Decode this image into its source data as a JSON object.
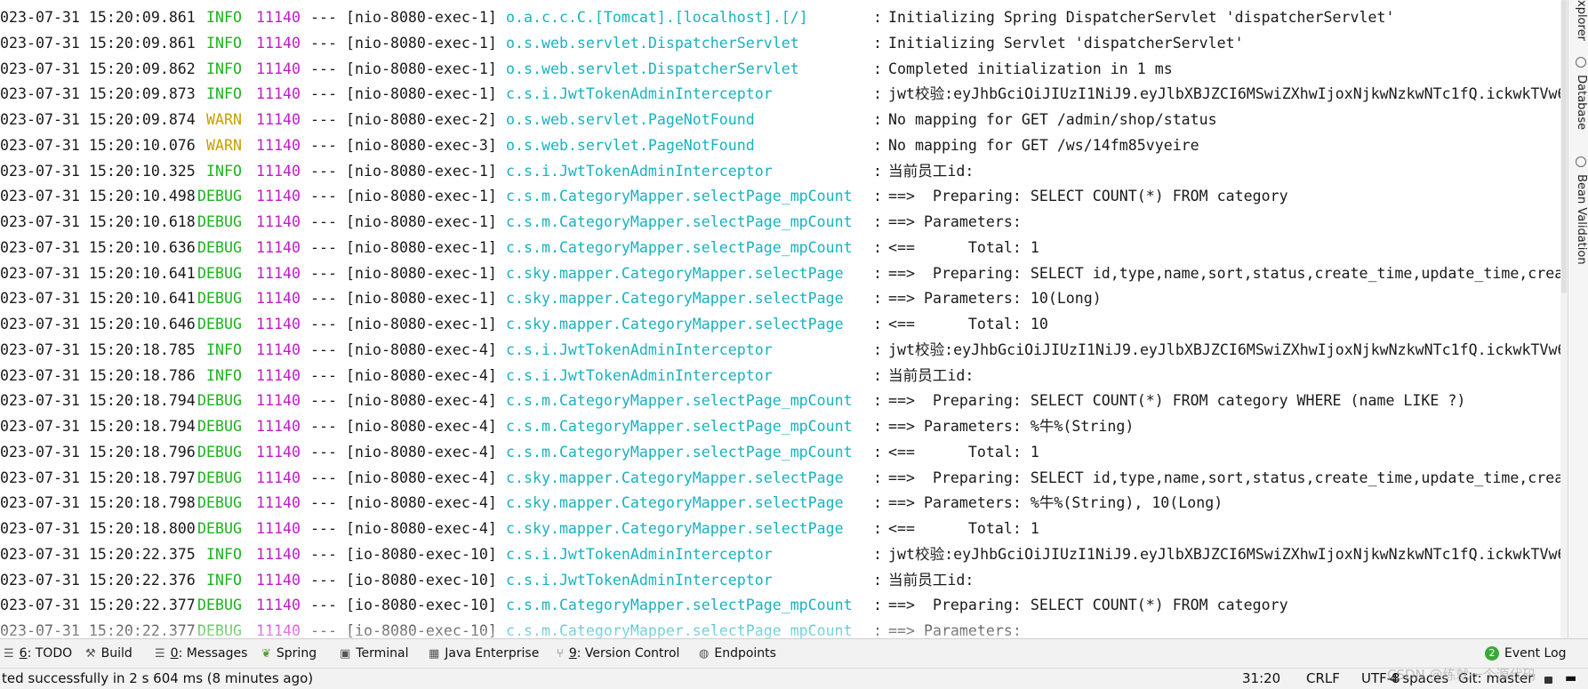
{
  "console": {
    "lines": [
      {
        "ts": "023-07-31 15:20:09.861",
        "level": " INFO",
        "pid": "11140",
        "sep": "---",
        "thread": "[nio-8080-exec-1]",
        "logger": "o.a.c.c.C.[Tomcat].[localhost].[/]",
        "msg": "Initializing Spring DispatcherServlet 'dispatcherServlet'"
      },
      {
        "ts": "023-07-31 15:20:09.861",
        "level": " INFO",
        "pid": "11140",
        "sep": "---",
        "thread": "[nio-8080-exec-1]",
        "logger": "o.s.web.servlet.DispatcherServlet",
        "msg": "Initializing Servlet 'dispatcherServlet'"
      },
      {
        "ts": "023-07-31 15:20:09.862",
        "level": " INFO",
        "pid": "11140",
        "sep": "---",
        "thread": "[nio-8080-exec-1]",
        "logger": "o.s.web.servlet.DispatcherServlet",
        "msg": "Completed initialization in 1 ms"
      },
      {
        "ts": "023-07-31 15:20:09.873",
        "level": " INFO",
        "pid": "11140",
        "sep": "---",
        "thread": "[nio-8080-exec-1]",
        "logger": "c.s.i.JwtTokenAdminInterceptor",
        "msg": "jwt校验:eyJhbGciOiJIUzI1NiJ9.eyJlbXBJZCI6MSwiZXhwIjoxNjkwNzkwNTc1fQ.ickwkTVw6"
      },
      {
        "ts": "023-07-31 15:20:09.874",
        "level": " WARN",
        "pid": "11140",
        "sep": "---",
        "thread": "[nio-8080-exec-2]",
        "logger": "o.s.web.servlet.PageNotFound",
        "msg": "No mapping for GET /admin/shop/status"
      },
      {
        "ts": "023-07-31 15:20:10.076",
        "level": " WARN",
        "pid": "11140",
        "sep": "---",
        "thread": "[nio-8080-exec-3]",
        "logger": "o.s.web.servlet.PageNotFound",
        "msg": "No mapping for GET /ws/14fm85vyeire"
      },
      {
        "ts": "023-07-31 15:20:10.325",
        "level": " INFO",
        "pid": "11140",
        "sep": "---",
        "thread": "[nio-8080-exec-1]",
        "logger": "c.s.i.JwtTokenAdminInterceptor",
        "msg": "当前员工id:"
      },
      {
        "ts": "023-07-31 15:20:10.498",
        "level": "DEBUG",
        "pid": "11140",
        "sep": "---",
        "thread": "[nio-8080-exec-1]",
        "logger": "c.s.m.CategoryMapper.selectPage_mpCount",
        "msg": "==>  Preparing: SELECT COUNT(*) FROM category"
      },
      {
        "ts": "023-07-31 15:20:10.618",
        "level": "DEBUG",
        "pid": "11140",
        "sep": "---",
        "thread": "[nio-8080-exec-1]",
        "logger": "c.s.m.CategoryMapper.selectPage_mpCount",
        "msg": "==> Parameters:"
      },
      {
        "ts": "023-07-31 15:20:10.636",
        "level": "DEBUG",
        "pid": "11140",
        "sep": "---",
        "thread": "[nio-8080-exec-1]",
        "logger": "c.s.m.CategoryMapper.selectPage_mpCount",
        "msg": "<==      Total: 1"
      },
      {
        "ts": "023-07-31 15:20:10.641",
        "level": "DEBUG",
        "pid": "11140",
        "sep": "---",
        "thread": "[nio-8080-exec-1]",
        "logger": "c.sky.mapper.CategoryMapper.selectPage",
        "msg": "==>  Preparing: SELECT id,type,name,sort,status,create_time,update_time,creat"
      },
      {
        "ts": "023-07-31 15:20:10.641",
        "level": "DEBUG",
        "pid": "11140",
        "sep": "---",
        "thread": "[nio-8080-exec-1]",
        "logger": "c.sky.mapper.CategoryMapper.selectPage",
        "msg": "==> Parameters: 10(Long)"
      },
      {
        "ts": "023-07-31 15:20:10.646",
        "level": "DEBUG",
        "pid": "11140",
        "sep": "---",
        "thread": "[nio-8080-exec-1]",
        "logger": "c.sky.mapper.CategoryMapper.selectPage",
        "msg": "<==      Total: 10"
      },
      {
        "ts": "023-07-31 15:20:18.785",
        "level": " INFO",
        "pid": "11140",
        "sep": "---",
        "thread": "[nio-8080-exec-4]",
        "logger": "c.s.i.JwtTokenAdminInterceptor",
        "msg": "jwt校验:eyJhbGciOiJIUzI1NiJ9.eyJlbXBJZCI6MSwiZXhwIjoxNjkwNzkwNTc1fQ.ickwkTVw6"
      },
      {
        "ts": "023-07-31 15:20:18.786",
        "level": " INFO",
        "pid": "11140",
        "sep": "---",
        "thread": "[nio-8080-exec-4]",
        "logger": "c.s.i.JwtTokenAdminInterceptor",
        "msg": "当前员工id:"
      },
      {
        "ts": "023-07-31 15:20:18.794",
        "level": "DEBUG",
        "pid": "11140",
        "sep": "---",
        "thread": "[nio-8080-exec-4]",
        "logger": "c.s.m.CategoryMapper.selectPage_mpCount",
        "msg": "==>  Preparing: SELECT COUNT(*) FROM category WHERE (name LIKE ?)"
      },
      {
        "ts": "023-07-31 15:20:18.794",
        "level": "DEBUG",
        "pid": "11140",
        "sep": "---",
        "thread": "[nio-8080-exec-4]",
        "logger": "c.s.m.CategoryMapper.selectPage_mpCount",
        "msg": "==> Parameters: %牛%(String)"
      },
      {
        "ts": "023-07-31 15:20:18.796",
        "level": "DEBUG",
        "pid": "11140",
        "sep": "---",
        "thread": "[nio-8080-exec-4]",
        "logger": "c.s.m.CategoryMapper.selectPage_mpCount",
        "msg": "<==      Total: 1"
      },
      {
        "ts": "023-07-31 15:20:18.797",
        "level": "DEBUG",
        "pid": "11140",
        "sep": "---",
        "thread": "[nio-8080-exec-4]",
        "logger": "c.sky.mapper.CategoryMapper.selectPage",
        "msg": "==>  Preparing: SELECT id,type,name,sort,status,create_time,update_time,creat"
      },
      {
        "ts": "023-07-31 15:20:18.798",
        "level": "DEBUG",
        "pid": "11140",
        "sep": "---",
        "thread": "[nio-8080-exec-4]",
        "logger": "c.sky.mapper.CategoryMapper.selectPage",
        "msg": "==> Parameters: %牛%(String), 10(Long)"
      },
      {
        "ts": "023-07-31 15:20:18.800",
        "level": "DEBUG",
        "pid": "11140",
        "sep": "---",
        "thread": "[nio-8080-exec-4]",
        "logger": "c.sky.mapper.CategoryMapper.selectPage",
        "msg": "<==      Total: 1"
      },
      {
        "ts": "023-07-31 15:20:22.375",
        "level": " INFO",
        "pid": "11140",
        "sep": "---",
        "thread": "[io-8080-exec-10]",
        "logger": "c.s.i.JwtTokenAdminInterceptor",
        "msg": "jwt校验:eyJhbGciOiJIUzI1NiJ9.eyJlbXBJZCI6MSwiZXhwIjoxNjkwNzkwNTc1fQ.ickwkTVw6"
      },
      {
        "ts": "023-07-31 15:20:22.376",
        "level": " INFO",
        "pid": "11140",
        "sep": "---",
        "thread": "[io-8080-exec-10]",
        "logger": "c.s.i.JwtTokenAdminInterceptor",
        "msg": "当前员工id:"
      },
      {
        "ts": "023-07-31 15:20:22.377",
        "level": "DEBUG",
        "pid": "11140",
        "sep": "---",
        "thread": "[io-8080-exec-10]",
        "logger": "c.s.m.CategoryMapper.selectPage_mpCount",
        "msg": "==>  Preparing: SELECT COUNT(*) FROM category"
      },
      {
        "ts": "023-07-31 15:20:22.377",
        "level": "DEBUG",
        "pid": "11140",
        "sep": "---",
        "thread": "[io-8080-exec-10]",
        "logger": "c.s.m.CategoryMapper.selectPage_mpCount",
        "msg": "==> Parameters:"
      }
    ]
  },
  "right_sidebar": {
    "tabs": [
      {
        "label": "xplorer",
        "icon": "explorer-icon"
      },
      {
        "label": "Database",
        "icon": "database-icon"
      },
      {
        "label": "Bean Validation",
        "icon": "bean-validation-icon"
      }
    ]
  },
  "tool_windows": {
    "todo": {
      "num": "6",
      "label": ": TODO",
      "icon": "list-icon"
    },
    "build": {
      "label": "Build",
      "icon": "hammer-icon"
    },
    "messages": {
      "num": "0",
      "label": ": Messages",
      "icon": "messages-icon"
    },
    "spring": {
      "label": "Spring",
      "icon": "spring-leaf-icon"
    },
    "terminal": {
      "label": "Terminal",
      "icon": "terminal-icon"
    },
    "java_enterprise": {
      "label": "Java Enterprise",
      "icon": "java-enterprise-icon"
    },
    "version_control": {
      "num": "9",
      "label": ": Version Control",
      "icon": "branch-icon"
    },
    "endpoints": {
      "label": "Endpoints",
      "icon": "globe-icon"
    },
    "event_log": {
      "badge": "2",
      "label": "Event Log",
      "icon": "event-log-icon"
    }
  },
  "status_bar": {
    "message": "ted successfully in 2 s 604 ms (8 minutes ago)",
    "position": "31:20",
    "line_separator": "CRLF",
    "encoding": "UTF-8",
    "indent": "4 spaces",
    "git": "Git: master"
  },
  "watermark": "CSDN @练就一个源代码",
  "colors": {
    "info": "#1cb31c",
    "warn": "#c8a000",
    "debug": "#1cb31c",
    "pid": "#c21bc8",
    "logger": "#19b2bf",
    "text": "#1a1a1a"
  }
}
